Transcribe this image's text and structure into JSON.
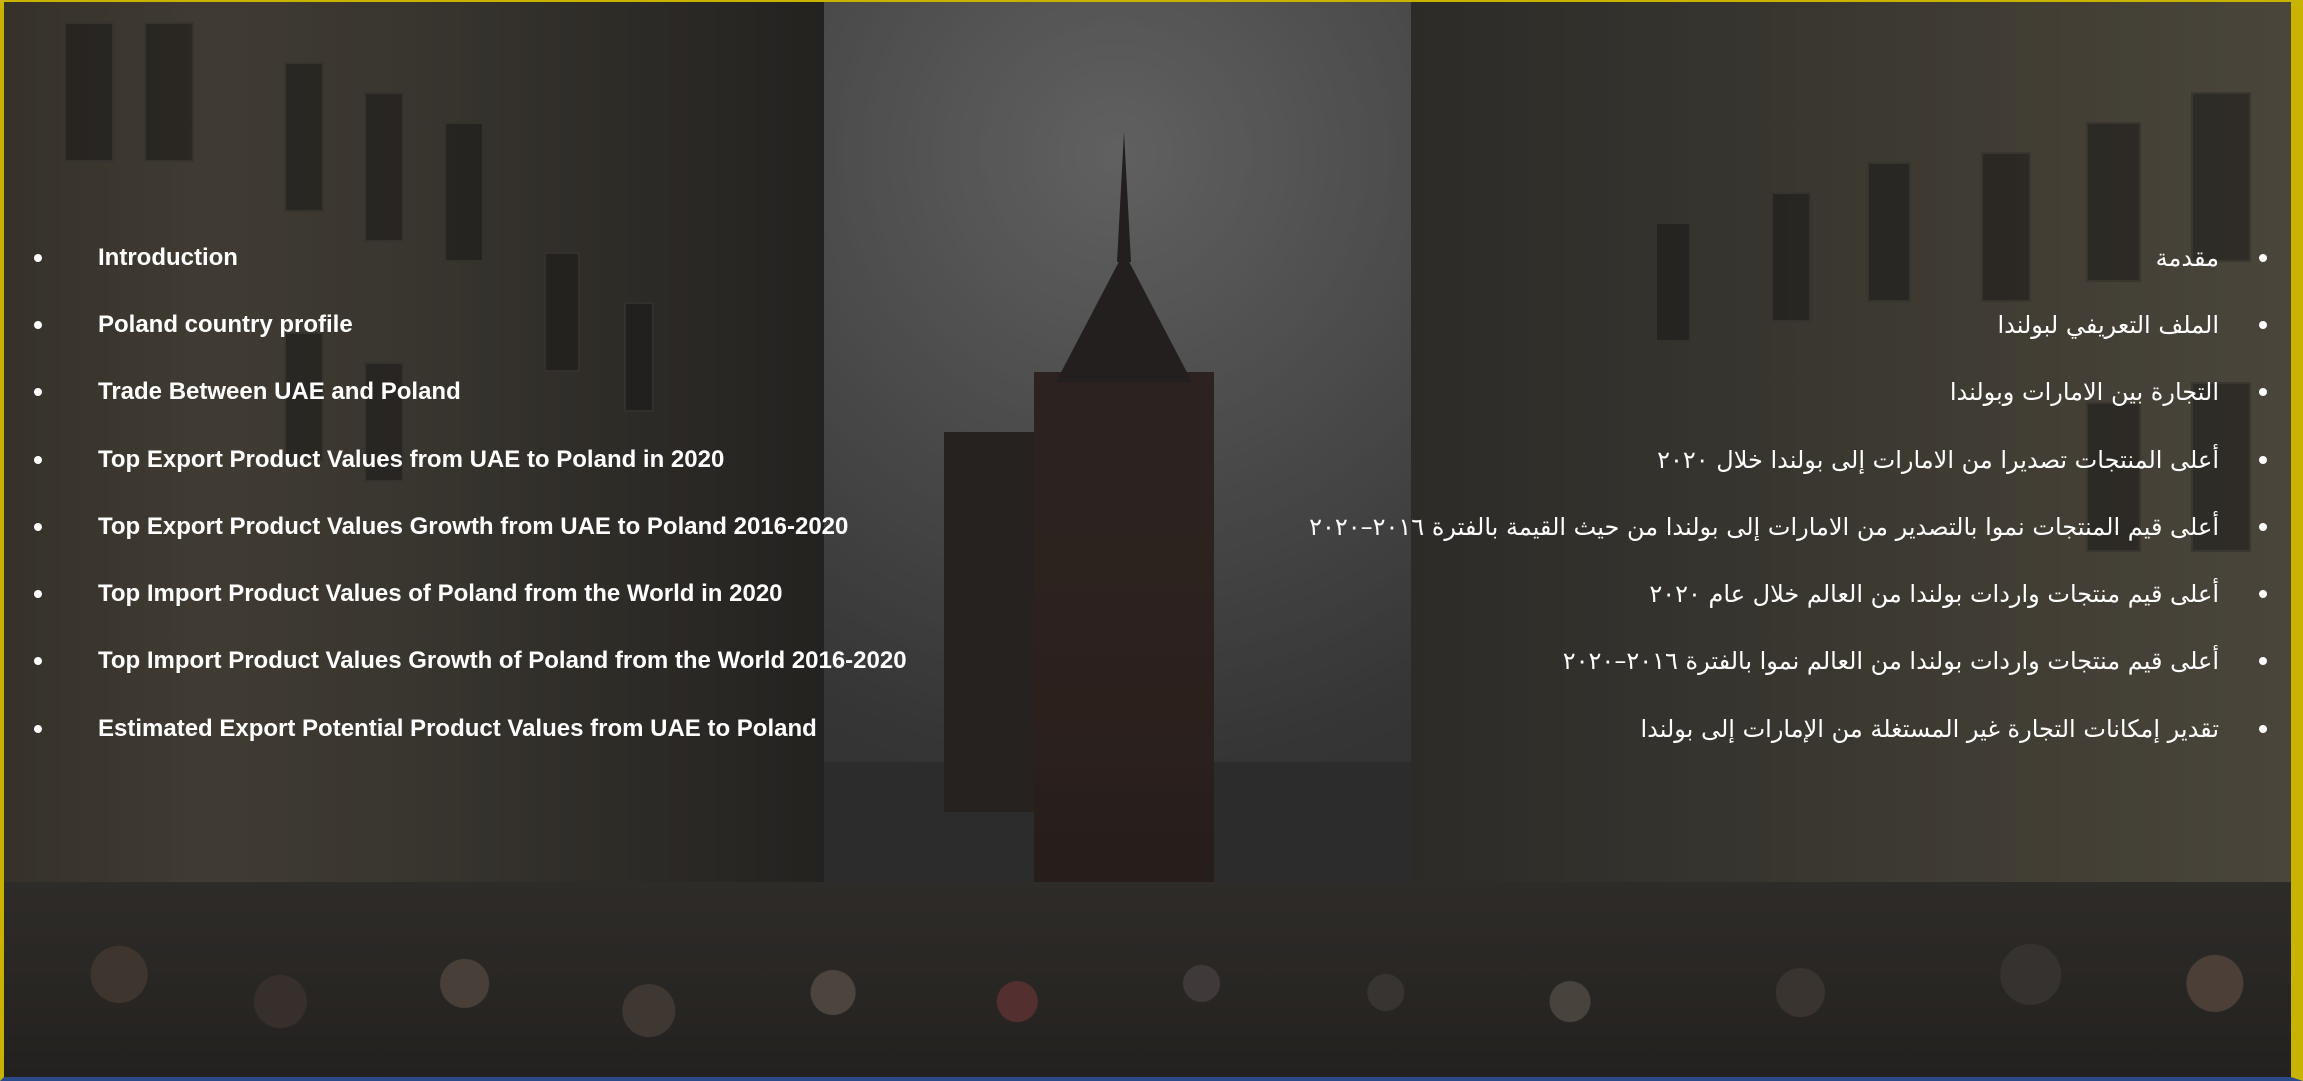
{
  "agenda": {
    "english": [
      "Introduction",
      "Poland country profile",
      "Trade Between UAE and Poland",
      "Top Export Product Values from UAE to Poland in 2020",
      "Top Export Product Values Growth from UAE to Poland 2016-2020",
      "Top Import Product Values of Poland from the World in 2020",
      "Top Import Product Values  Growth of Poland from the World  2016-2020",
      "Estimated Export Potential Product Values from UAE to Poland"
    ],
    "arabic": [
      "مقدمة",
      "الملف التعريفي لبولندا",
      "التجارة بين الامارات وبولندا",
      "أعلى المنتجات تصديرا من الامارات إلى بولندا خلال ٢٠٢٠",
      "أعلى قيم المنتجات نموا بالتصدير من الامارات إلى بولندا  من حيث القيمة بالفترة ٢٠١٦–٢٠٢٠",
      "أعلى قيم منتجات واردات بولندا من العالم خلال عام ٢٠٢٠",
      "أعلى قيم منتجات واردات بولندا من العالم نموا بالفترة ٢٠١٦–٢٠٢٠",
      "تقدير إمكانات التجارة غير المستغلة من الإمارات إلى بولندا"
    ]
  },
  "colors": {
    "frame_accent": "#c8b400",
    "bottom_accent": "#2a4a8a",
    "text": "#ffffff"
  }
}
